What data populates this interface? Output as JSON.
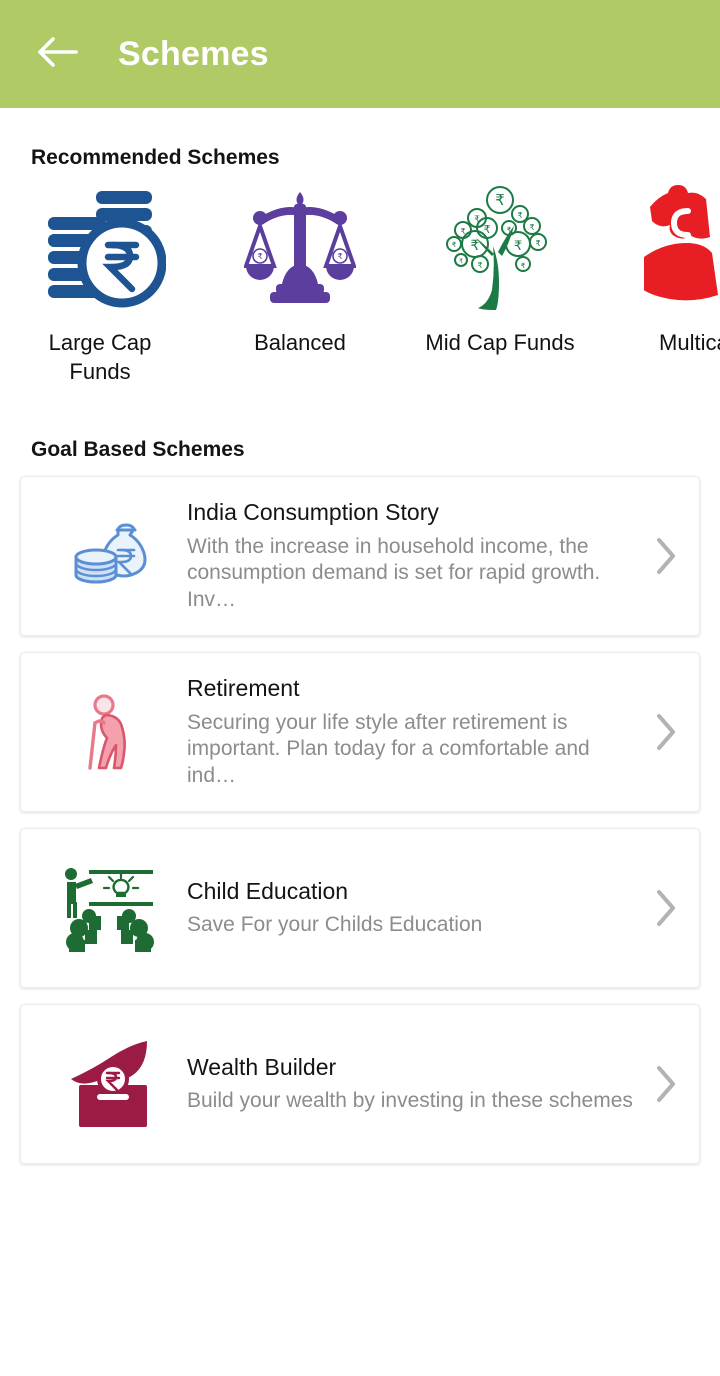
{
  "appbar": {
    "title": "Schemes",
    "back_icon": "arrow-left-icon",
    "background_color": "#b0ca66",
    "title_color": "#ffffff"
  },
  "recommended": {
    "heading": "Recommended Schemes",
    "items": [
      {
        "label": "Large Cap\nFunds",
        "icon": "coin-stack-rupee-icon",
        "color": "#1f5493"
      },
      {
        "label": "Balanced",
        "icon": "balance-scale-icon",
        "color": "#5b3e9e"
      },
      {
        "label": "Mid Cap Funds",
        "icon": "money-tree-icon",
        "color": "#1c7a45"
      },
      {
        "label": "Multicap",
        "icon": "puzzle-piece-icon",
        "color": "#e81e25"
      }
    ]
  },
  "goal_based": {
    "heading": "Goal Based Schemes",
    "chevron_icon": "chevron-right-icon",
    "chevron_color": "#b3b3b3",
    "cards": [
      {
        "title": "India Consumption Story",
        "description": "With the increase in household income, the consumption demand is set for rapid growth. Inv…",
        "icon": "money-bag-coins-icon",
        "color": "#5b8fd4"
      },
      {
        "title": "Retirement",
        "description": "Securing your life style after retirement is important. Plan today for a comfortable and ind…",
        "icon": "elderly-person-cane-icon",
        "color": "#e8798a"
      },
      {
        "title": "Child Education",
        "description": "Save For your Childs Education",
        "icon": "classroom-students-icon",
        "color": "#1e6b33"
      },
      {
        "title": "Wealth Builder",
        "description": "Build your wealth by investing in these schemes",
        "icon": "hand-coin-donation-box-icon",
        "color": "#9b1b45"
      }
    ]
  }
}
